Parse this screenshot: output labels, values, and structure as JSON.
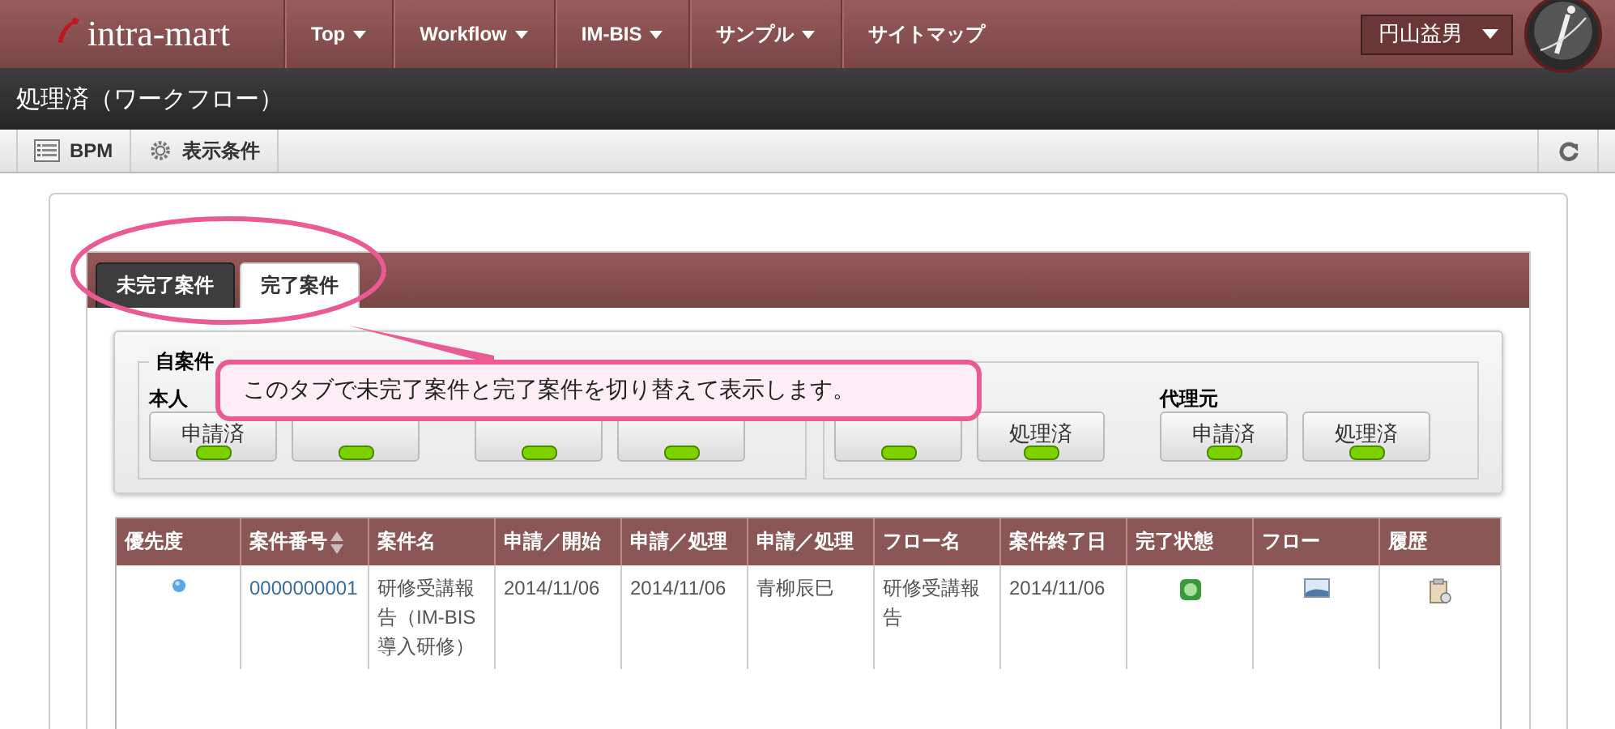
{
  "header": {
    "logo": "intra-mart",
    "nav": [
      {
        "label": "Top",
        "dropdown": true
      },
      {
        "label": "Workflow",
        "dropdown": true
      },
      {
        "label": "IM-BIS",
        "dropdown": true
      },
      {
        "label": "サンプル",
        "dropdown": true
      },
      {
        "label": "サイトマップ",
        "dropdown": false
      }
    ],
    "user": "円山益男"
  },
  "page_title": "処理済（ワークフロー）",
  "toolbar": [
    {
      "label": "BPM",
      "kind": "list"
    },
    {
      "label": "表示条件",
      "kind": "gear"
    }
  ],
  "tabs": [
    {
      "label": "未完了案件",
      "selected": false
    },
    {
      "label": "完了案件",
      "selected": true
    }
  ],
  "filter_groups": [
    {
      "legend": "自案件",
      "subgroups": [
        {
          "label": "本人",
          "buttons": [
            {
              "label": "申請済",
              "lit": true
            },
            {
              "lit": true
            }
          ]
        },
        {
          "buttons": [
            {
              "lit": true
            },
            {
              "lit": true
            }
          ]
        }
      ]
    },
    {
      "subgroups": [
        {
          "buttons": [
            {
              "lit": true
            },
            {
              "label": "処理済",
              "lit": true
            }
          ]
        },
        {
          "label": "代理元",
          "buttons": [
            {
              "label": "申請済",
              "lit": true
            },
            {
              "label": "処理済",
              "lit": true
            }
          ]
        }
      ]
    }
  ],
  "callout": "このタブで未完了案件と完了案件を切り替えて表示します。",
  "table": {
    "columns": [
      {
        "label": "優先度",
        "sortable": false
      },
      {
        "label": "案件番号",
        "sortable": true
      },
      {
        "label": "案件名",
        "sortable": false
      },
      {
        "label": "申請／開始",
        "sortable": false
      },
      {
        "label": "申請／処理",
        "sortable": false
      },
      {
        "label": "申請／処理",
        "sortable": false
      },
      {
        "label": "フロー名",
        "sortable": false
      },
      {
        "label": "案件終了日",
        "sortable": false
      },
      {
        "label": "完了状態",
        "sortable": false
      },
      {
        "label": "フロー",
        "sortable": false
      },
      {
        "label": "履歴",
        "sortable": false
      }
    ],
    "rows": [
      [
        {
          "kind": "dot"
        },
        {
          "kind": "link",
          "text": "0000000001"
        },
        {
          "kind": "text",
          "text": "研修受講報告（IM-BIS導入研修）"
        },
        {
          "kind": "text",
          "text": "2014/11/06"
        },
        {
          "kind": "text",
          "text": "2014/11/06"
        },
        {
          "kind": "text",
          "text": "青柳辰巳"
        },
        {
          "kind": "text",
          "text": "研修受講報告"
        },
        {
          "kind": "text",
          "text": "2014/11/06"
        },
        {
          "kind": "status"
        },
        {
          "kind": "flow"
        },
        {
          "kind": "history"
        }
      ]
    ]
  }
}
